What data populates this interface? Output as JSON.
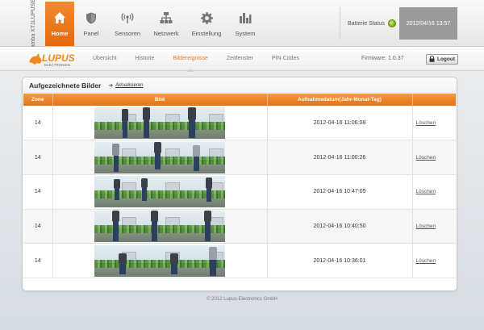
{
  "app": {
    "brand_vertical": [
      "LUPUSEC",
      "Namba XT1"
    ],
    "accent_color": "#e67116"
  },
  "nav": {
    "items": [
      {
        "label": "Home",
        "icon": "home-icon",
        "active": true
      },
      {
        "label": "Panel",
        "icon": "shield-icon",
        "active": false
      },
      {
        "label": "Sensoren",
        "icon": "sensor-icon",
        "active": false
      },
      {
        "label": "Netzwerk",
        "icon": "network-icon",
        "active": false
      },
      {
        "label": "Einstellung",
        "icon": "gear-icon",
        "active": false
      },
      {
        "label": "System",
        "icon": "bars-icon",
        "active": false
      }
    ]
  },
  "status": {
    "battery_label": "Batterie Status",
    "battery_color": "#7cb51a",
    "datetime": "2012/04/16 13:57"
  },
  "logo": {
    "name": "LUPUS",
    "sub": "ELECTRONICS"
  },
  "subnav": {
    "items": [
      {
        "label": "Übersicht",
        "active": false
      },
      {
        "label": "Historie",
        "active": false
      },
      {
        "label": "Bildereignisse",
        "active": true
      },
      {
        "label": "Zeitfenster",
        "active": false
      },
      {
        "label": "PIN Codes",
        "active": false
      }
    ],
    "firmware": "Firmware: 1.0.37",
    "logout": "Logout"
  },
  "panel": {
    "title": "Aufgezeichnete Bilder",
    "refresh": "Aktualisieren",
    "columns": [
      "Zone",
      "Bild",
      "Aufnahmedatum(Jahr-Monat-Tag)",
      ""
    ],
    "rows": [
      {
        "zone": "14",
        "date": "2012-04-16 11:06:08",
        "delete": "Löschen"
      },
      {
        "zone": "14",
        "date": "2012-04-16 11:00:26",
        "delete": "Löschen"
      },
      {
        "zone": "14",
        "date": "2012-04-16 10:47:05",
        "delete": "Löschen"
      },
      {
        "zone": "14",
        "date": "2012-04-16 10:40:50",
        "delete": "Löschen"
      },
      {
        "zone": "14",
        "date": "2012-04-16 10:36:01",
        "delete": "Löschen"
      }
    ]
  },
  "footer": "© 2012 Lupus-Electronics GmbH"
}
